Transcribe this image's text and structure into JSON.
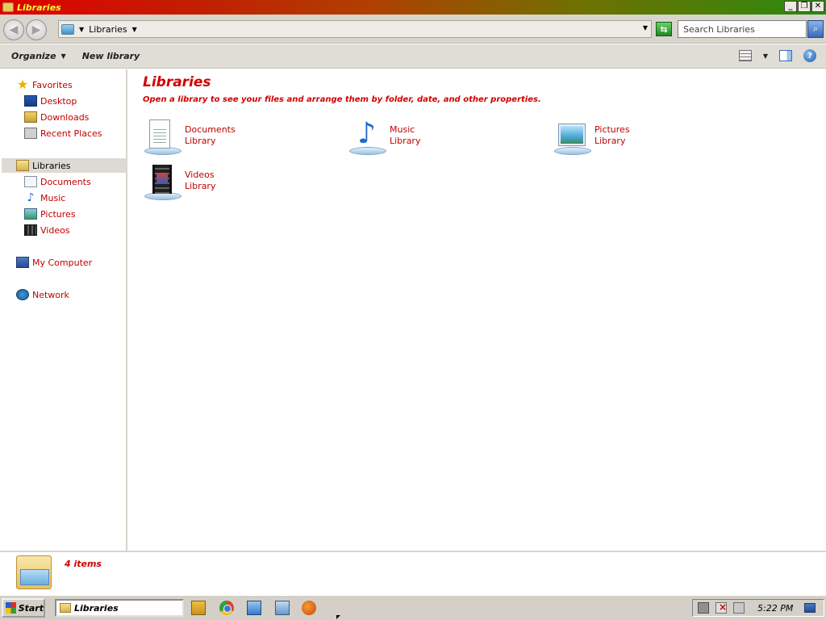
{
  "window": {
    "title": "Libraries",
    "buttons": {
      "minimize": "_",
      "maximize": "❐",
      "close": "✕"
    }
  },
  "address": {
    "path": "Libraries",
    "search_placeholder": "Search Libraries"
  },
  "commandbar": {
    "organize": "Organize",
    "new_library": "New library"
  },
  "nav": {
    "favorites": {
      "label": "Favorites",
      "items": [
        "Desktop",
        "Downloads",
        "Recent Places"
      ]
    },
    "libraries": {
      "label": "Libraries",
      "items": [
        "Documents",
        "Music",
        "Pictures",
        "Videos"
      ]
    },
    "computer": "My Computer",
    "network": "Network"
  },
  "content": {
    "title": "Libraries",
    "subtitle": "Open a library to see your files and arrange them by folder, date, and other properties.",
    "libraries": [
      {
        "name": "Documents",
        "kind": "Library",
        "icon": "documents-library-icon"
      },
      {
        "name": "Music",
        "kind": "Library",
        "icon": "music-library-icon"
      },
      {
        "name": "Pictures",
        "kind": "Library",
        "icon": "pictures-library-icon"
      },
      {
        "name": "Videos",
        "kind": "Library",
        "icon": "videos-library-icon"
      }
    ]
  },
  "details": {
    "count": "4 items"
  },
  "taskbar": {
    "start": "Start",
    "task": "Libraries",
    "clock": "5:22 PM"
  },
  "colors": {
    "accent_red": "#d00000",
    "nav_text": "#c00000"
  }
}
